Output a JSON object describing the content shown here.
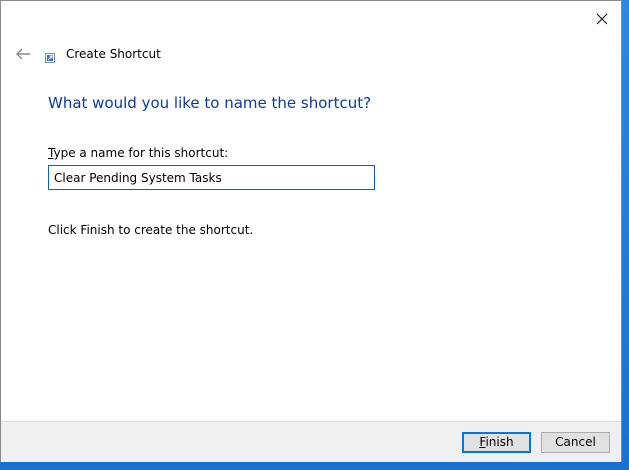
{
  "window": {
    "title": "Create Shortcut",
    "close_icon": "close-icon",
    "back_icon": "back-arrow-icon",
    "app_icon": "shortcut-icon"
  },
  "main": {
    "heading": "What would you like to name the shortcut?",
    "field_label_access_key": "T",
    "field_label_rest": "ype a name for this shortcut:",
    "name_value": "Clear Pending System Tasks",
    "hint": "Click Finish to create the shortcut."
  },
  "footer": {
    "finish_access_key": "F",
    "finish_rest": "inish",
    "cancel_label": "Cancel"
  },
  "colors": {
    "heading": "#0f3b93",
    "focus_border": "#0078d7",
    "footer_bg": "#f0f0f0",
    "desktop": "#1a6fd0"
  }
}
